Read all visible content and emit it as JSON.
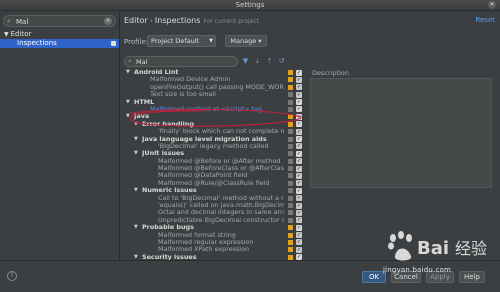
{
  "window": {
    "title": "Settings"
  },
  "left": {
    "search_value": "Mal",
    "tree": {
      "editor": "Editor",
      "inspections": "Inspections"
    }
  },
  "header": {
    "crumb_editor": "Editor",
    "crumb_sep": "›",
    "crumb_inspections": "Inspections",
    "crumb_hint": "For current project",
    "reset": "Reset"
  },
  "profile": {
    "label": "Profile:",
    "value": "Project Default",
    "manage": "Manage"
  },
  "inspection_search": {
    "value": "Mal"
  },
  "description_label": "Description",
  "rows": [
    {
      "type": "grp",
      "text": "Android Lint",
      "indent": 0,
      "sev": "orange"
    },
    {
      "type": "leaf",
      "text": "Malformed Device Admin",
      "indent": 2,
      "sev": "orange"
    },
    {
      "type": "leaf",
      "text": "openFileOutput() call passing MODE_WORLD_W...",
      "indent": 2,
      "sev": "orange"
    },
    {
      "type": "leaf",
      "text": "Text size is too small",
      "indent": 2,
      "sev": "gray"
    },
    {
      "type": "grp",
      "text": "HTML",
      "indent": 0,
      "sev": "gray",
      "circled": true
    },
    {
      "type": "match",
      "text": "Malformed content of <script> tag",
      "indent": 2,
      "sev": "gray"
    },
    {
      "type": "grp",
      "text": "Java",
      "indent": 0,
      "sev": "orange"
    },
    {
      "type": "grp",
      "text": "Error handling",
      "indent": 1,
      "sev": "orange"
    },
    {
      "type": "leaf",
      "text": "'finally' block which can not complete normal",
      "indent": 3,
      "sev": "gray"
    },
    {
      "type": "grp",
      "text": "Java language level migration aids",
      "indent": 1,
      "sev": "gray"
    },
    {
      "type": "leaf",
      "text": "'BigDecimal' legacy method called",
      "indent": 3,
      "sev": "gray"
    },
    {
      "type": "grp",
      "text": "JUnit issues",
      "indent": 1,
      "sev": "gray"
    },
    {
      "type": "leaf",
      "text": "Malformed @Before or @After method",
      "indent": 3,
      "sev": "gray"
    },
    {
      "type": "leaf",
      "text": "Malformed @BeforeClass or @AfterClass m",
      "indent": 3,
      "sev": "gray"
    },
    {
      "type": "leaf",
      "text": "Malformed @DataPoint field",
      "indent": 3,
      "sev": "gray"
    },
    {
      "type": "leaf",
      "text": "Malformed @Rule/@ClassRule field",
      "indent": 3,
      "sev": "gray"
    },
    {
      "type": "grp",
      "text": "Numeric issues",
      "indent": 1,
      "sev": "gray"
    },
    {
      "type": "leaf",
      "text": "Call to 'BigDecimal' method without a roundi",
      "indent": 3,
      "sev": "gray"
    },
    {
      "type": "leaf",
      "text": "'equals()' called on java.math.BigDecimal",
      "indent": 3,
      "sev": "gray"
    },
    {
      "type": "leaf",
      "text": "Octal and decimal integers in same array",
      "indent": 3,
      "sev": "gray"
    },
    {
      "type": "leaf",
      "text": "Unpredictable BigDecimal constructor call",
      "indent": 3,
      "sev": "gray"
    },
    {
      "type": "grp",
      "text": "Probable bugs",
      "indent": 1,
      "sev": "orange"
    },
    {
      "type": "leaf",
      "text": "Malformed format string",
      "indent": 3,
      "sev": "orange"
    },
    {
      "type": "leaf",
      "text": "Malformed regular expression",
      "indent": 3,
      "sev": "orange"
    },
    {
      "type": "leaf",
      "text": "Malformed XPath expression",
      "indent": 3,
      "sev": "orange"
    },
    {
      "type": "grp",
      "text": "Security issues",
      "indent": 1,
      "sev": "orange"
    }
  ],
  "buttons": {
    "ok": "OK",
    "cancel": "Cancel",
    "apply": "Apply",
    "help": "Help"
  },
  "watermark": {
    "brand": "Bai 经验",
    "url": "jingyan.baidu.com"
  },
  "colors": {
    "selection": "#2f65ca",
    "warning": "#e0a020",
    "annotation": "#c41f3a"
  }
}
